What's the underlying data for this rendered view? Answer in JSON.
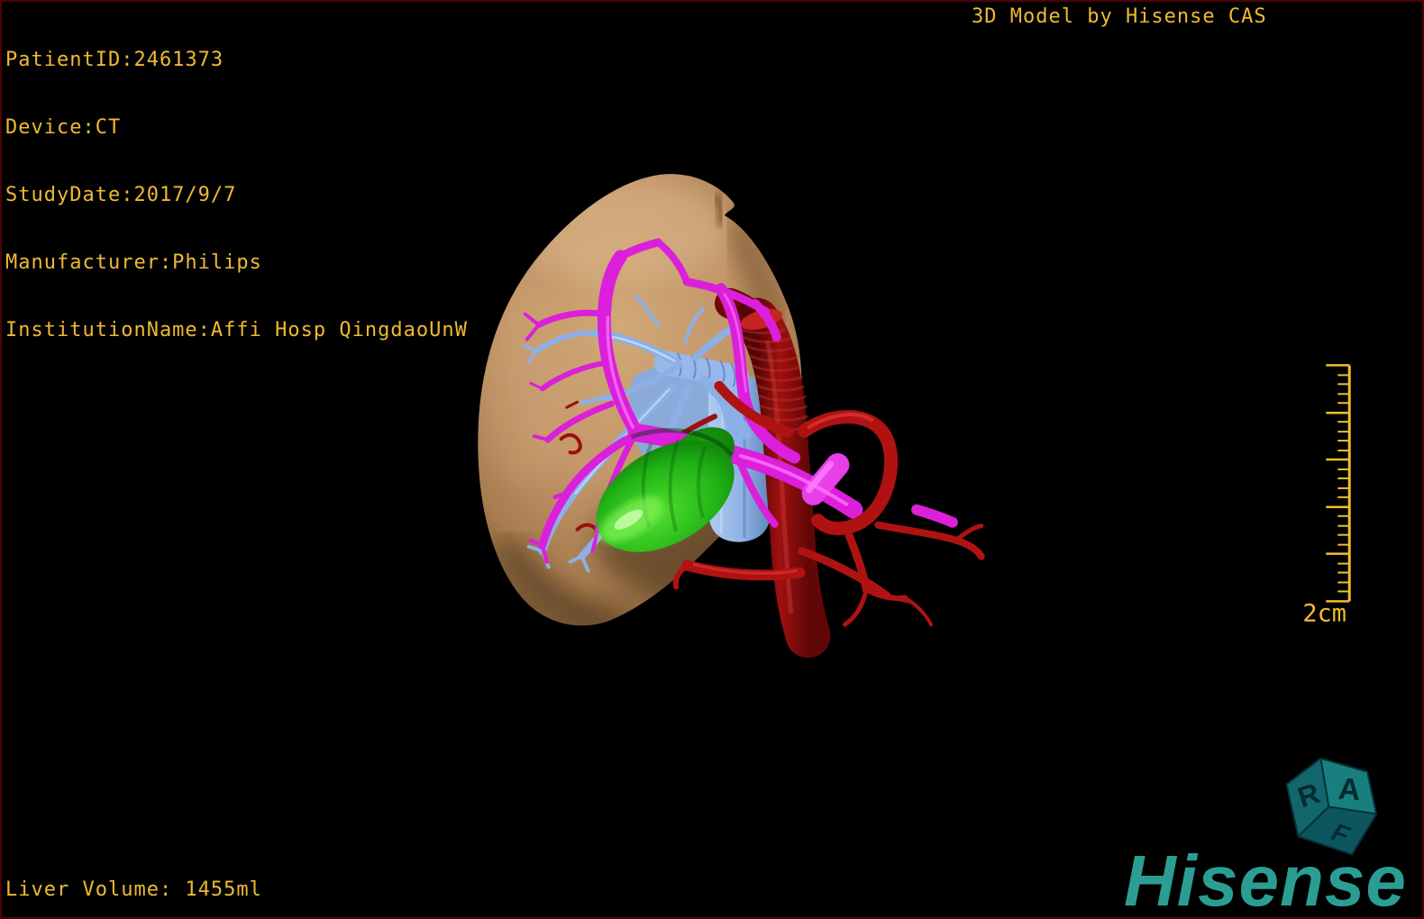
{
  "viewer": {
    "patient_info_lines": [
      "PatientID:2461373",
      "Device:CT",
      "StudyDate:2017/9/7",
      "Manufacturer:Philips",
      "InstitutionName:Affi Hosp QingdaoUnW"
    ],
    "watermark": "3D Model by Hisense CAS",
    "liver_volume_label": "Liver Volume: 1455ml",
    "scale_label": "2cm",
    "cube": {
      "letter_right": "R",
      "letter_anterior": "A",
      "letter_foot": "F"
    },
    "logo_text": "Hisense"
  },
  "colors": {
    "background": "#000000",
    "frame_border": "#4A0404",
    "overlay_text": "#EFBA30",
    "logo_teal": "#2B9E94",
    "orientation_cube_teal": "#14707A",
    "liver_tan": "#C3976A",
    "portal_vein_magenta": "#DB1FDB",
    "hepatic_vein_blue": "#8CB0E6",
    "artery_red": "#B01212",
    "vena_cava_dark_red": "#8A0D0D",
    "gallbladder_green": "#23B517"
  }
}
